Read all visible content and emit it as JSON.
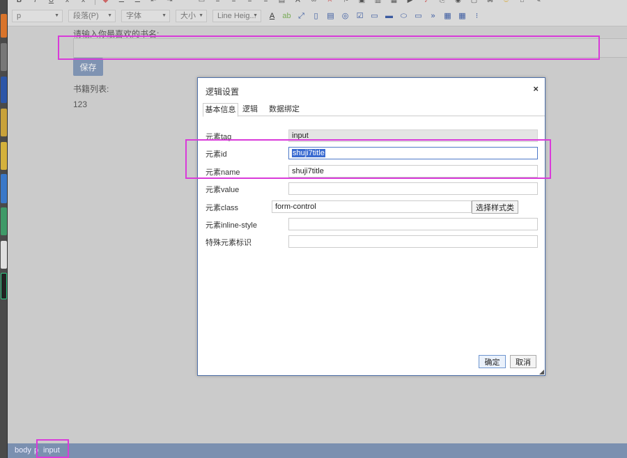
{
  "toolbar": {
    "paragraph_format": "p",
    "paragraph_style": "段落(P)",
    "font_family": "字体",
    "font_size": "大小",
    "line_height": "Line Heig..."
  },
  "editor": {
    "prompt": "请输入你最喜欢的书名:",
    "save_label": "保存",
    "list_label": "书籍列表:",
    "list_value": "123"
  },
  "statusbar": {
    "crumb_body": "body",
    "crumb_p": "p",
    "crumb_input": "input"
  },
  "dialog": {
    "title": "逻辑设置",
    "close_glyph": "×",
    "tabs": [
      "基本信息",
      "逻辑",
      "数据绑定"
    ],
    "fields": {
      "tag": {
        "label": "元素tag",
        "value": "input"
      },
      "id": {
        "label": "元素id",
        "value": "shuji7title"
      },
      "name": {
        "label": "元素name",
        "value": "shuji7title"
      },
      "value": {
        "label": "元素value",
        "value": ""
      },
      "class": {
        "label": "元素class",
        "value": "form-control",
        "button": "选择样式类"
      },
      "inline_style": {
        "label": "元素inline-style",
        "value": ""
      },
      "special": {
        "label": "特殊元素标识",
        "value": ""
      }
    },
    "ok_label": "确定",
    "cancel_label": "取消"
  },
  "colors": {
    "highlight": "#d93ad9",
    "dialog_border": "#4d6fa8",
    "statusbar": "#7b90b0",
    "save_button": "#7f93b2",
    "selection": "#3a6bd1"
  },
  "icons": [
    "bold-icon",
    "italic-icon",
    "underline-icon",
    "subscript-icon",
    "eraser-icon",
    "list-icon",
    "indent-icon",
    "quote-icon",
    "align-left-icon",
    "align-center-icon",
    "align-right-icon",
    "justify-icon",
    "font-color-icon",
    "highlight-icon",
    "fullscreen-icon",
    "checkbox-icon",
    "table-icon",
    "grid-icon"
  ]
}
